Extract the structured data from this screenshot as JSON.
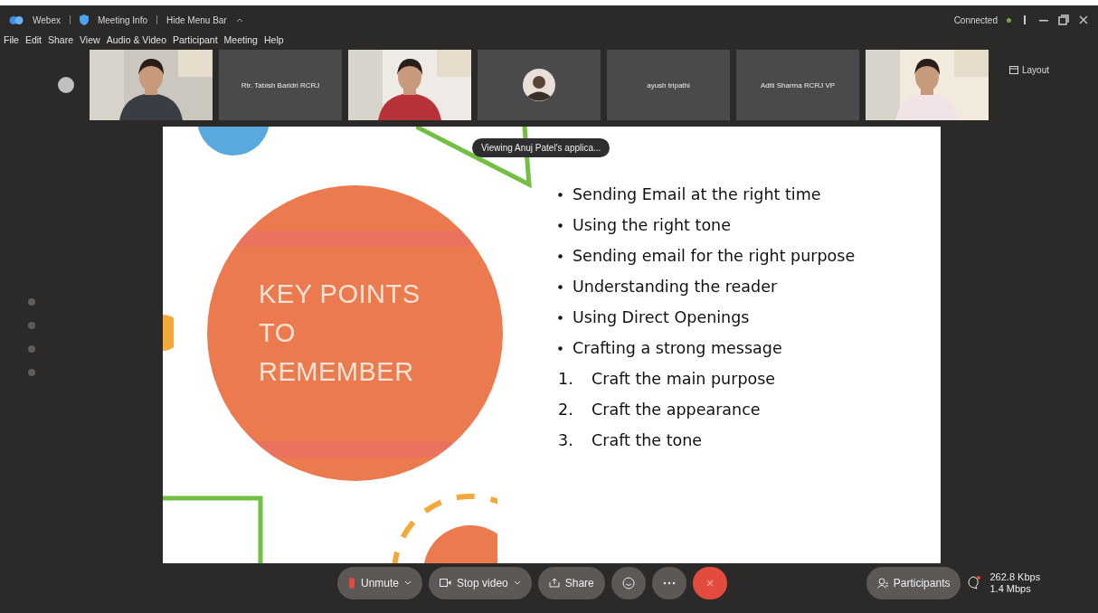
{
  "window": {
    "app": "Webex",
    "meeting_info": "Meeting Info",
    "hide_menu_bar": "Hide Menu Bar",
    "status": "Connected"
  },
  "menu": [
    "File",
    "Edit",
    "Share",
    "View",
    "Audio & Video",
    "Participant",
    "Meeting",
    "Help"
  ],
  "participants": [
    {
      "kind": "video"
    },
    {
      "kind": "name",
      "name": "Rtr. Tabish Baridri RCRJ"
    },
    {
      "kind": "video"
    },
    {
      "kind": "avatar"
    },
    {
      "kind": "name",
      "name": "ayush tripathi"
    },
    {
      "kind": "name",
      "name": "Aditi Sharma RCRJ VP"
    },
    {
      "kind": "video"
    }
  ],
  "layout_button": "Layout",
  "share_banner": "Viewing Anuj Patel's applica...",
  "slide": {
    "title_lines": [
      "KEY POINTS",
      "TO",
      "REMEMBER"
    ],
    "points": [
      {
        "kind": "bullet",
        "text": "Sending Email at the right time"
      },
      {
        "kind": "bullet",
        "text": "Using the right tone"
      },
      {
        "kind": "bullet",
        "text": "Sending email for the right purpose"
      },
      {
        "kind": "bullet",
        "text": "Understanding the reader"
      },
      {
        "kind": "bullet",
        "text": "Using Direct Openings"
      },
      {
        "kind": "bullet",
        "text": "Crafting a strong message"
      },
      {
        "kind": "numbered",
        "number": "1.",
        "text": "Craft the main purpose"
      },
      {
        "kind": "numbered",
        "number": "2.",
        "text": "Craft the appearance"
      },
      {
        "kind": "numbered",
        "number": "3.",
        "text": "Craft the tone"
      }
    ]
  },
  "controls": [
    {
      "kind": "mic",
      "label": "Unmute",
      "dropdown": true
    },
    {
      "kind": "camera",
      "label": "Stop video",
      "dropdown": true
    },
    {
      "kind": "share",
      "label": "Share",
      "dropdown": false
    },
    {
      "kind": "reactions",
      "dropdown": false
    },
    {
      "kind": "more",
      "dropdown": false
    },
    {
      "kind": "leave",
      "dropdown": false
    }
  ],
  "participants_button": "Participants",
  "stats": [
    "262.8 Kbps",
    "1.4 Mbps"
  ]
}
